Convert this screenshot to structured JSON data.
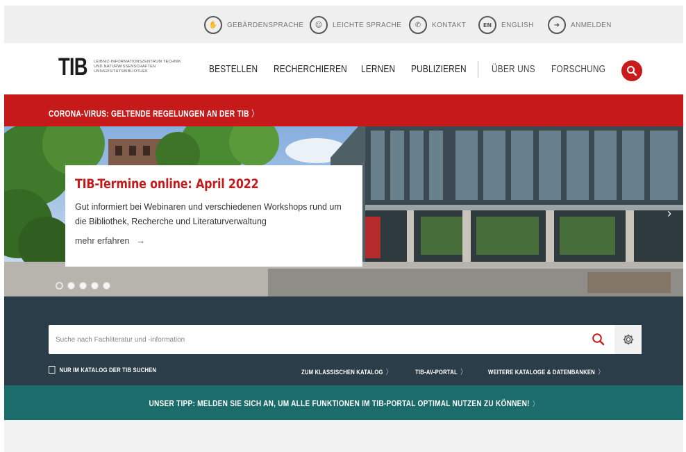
{
  "utility_bar": {
    "items": [
      {
        "label": "GEBÄRDENSPRACHE",
        "icon": "hand-sign-icon",
        "glyph": "✋"
      },
      {
        "label": "LEICHTE SPRACHE",
        "icon": "easy-language-icon",
        "glyph": "☺"
      },
      {
        "label": "KONTAKT",
        "icon": "contact-icon",
        "glyph": "✆"
      },
      {
        "label": "ENGLISH",
        "icon": "language-en-icon",
        "glyph": "EN"
      },
      {
        "label": "ANMELDEN",
        "icon": "login-icon",
        "glyph": "➜"
      }
    ]
  },
  "header": {
    "logo_text": "TIB",
    "logo_subtitle": "Leibniz-Informationszentrum Technik und Naturwissenschaften Universitätsbibliothek",
    "nav": [
      "BESTELLEN",
      "RECHERCHIEREN",
      "LERNEN",
      "PUBLIZIEREN",
      "ÜBER UNS",
      "FORSCHUNG"
    ]
  },
  "corona_banner": {
    "text": "CORONA-VIRUS: GELTENDE REGELUNGEN AN DER TIB",
    "chevron": "〉"
  },
  "hero": {
    "title": "TIB-Termine online: April 2022",
    "description": "Gut informiert bei Webinaren und verschiedenen Workshops rund um die Bibliothek, Recherche und Literaturverwaltung",
    "more_link": "mehr erfahren",
    "more_arrow": "→",
    "next_arrow": "›",
    "slide_count": 5,
    "active_slide": 1
  },
  "search": {
    "placeholder": "Suche nach Fachliteratur und -information",
    "catalog_checkbox_label": "NUR IM KATALOG DER TIB SUCHEN",
    "links": [
      "ZUM KLASSISCHEN KATALOG",
      "TIB-AV-PORTAL",
      "WEITERE KATALOGE & DATENBANKEN"
    ],
    "chevron": "〉"
  },
  "tip_bar": {
    "text": "UNSER TIPP: MELDEN SIE SICH AN, UM ALLE FUNKTIONEN IM TIB-PORTAL OPTIMAL NUTZEN ZU KÖNNEN!",
    "chevron": "〉"
  },
  "colors": {
    "brand_red": "#c61a1a",
    "dark_slate": "#2b3d48",
    "teal": "#1b6c6b"
  }
}
